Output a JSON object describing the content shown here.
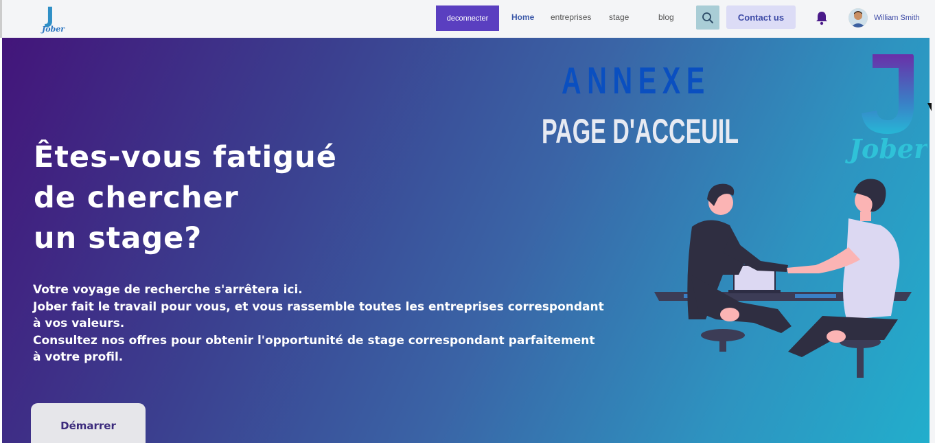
{
  "navbar": {
    "logo_text": "Jober",
    "deconnecter_label": "deconnecter",
    "links": [
      "Home",
      "entreprises",
      "stage",
      "blog"
    ],
    "contact_label": "Contact us",
    "user_name": "William Smith",
    "icons": {
      "search": "search-icon",
      "bell": "bell-icon"
    }
  },
  "hero": {
    "title_lines": [
      "Êtes-vous fatigué",
      "de chercher",
      "un stage?"
    ],
    "paragraph_lines": [
      "Votre voyage de recherche s'arrêtera ici.",
      "Jober fait le travail pour vous, et vous rassemble toutes les entreprises correspondant",
      "à vos valeurs.",
      "Consultez nos offres pour obtenir l'opportunité de stage correspondant parfaitement",
      "à votre profil."
    ],
    "start_label": "Démarrer",
    "annexe_label": "ANNEXE",
    "page_label": "PAGE D'ACCEUIL",
    "logo_text": "Jober"
  },
  "colors": {
    "accent_button": "#5a3fc0",
    "link_active": "#3b58a8",
    "contact_bg": "#dcdcf6",
    "search_bg": "#a9cdd6",
    "gradient_start": "#43157a",
    "gradient_end": "#22aecc",
    "annexe_color": "#0a4fc0"
  }
}
